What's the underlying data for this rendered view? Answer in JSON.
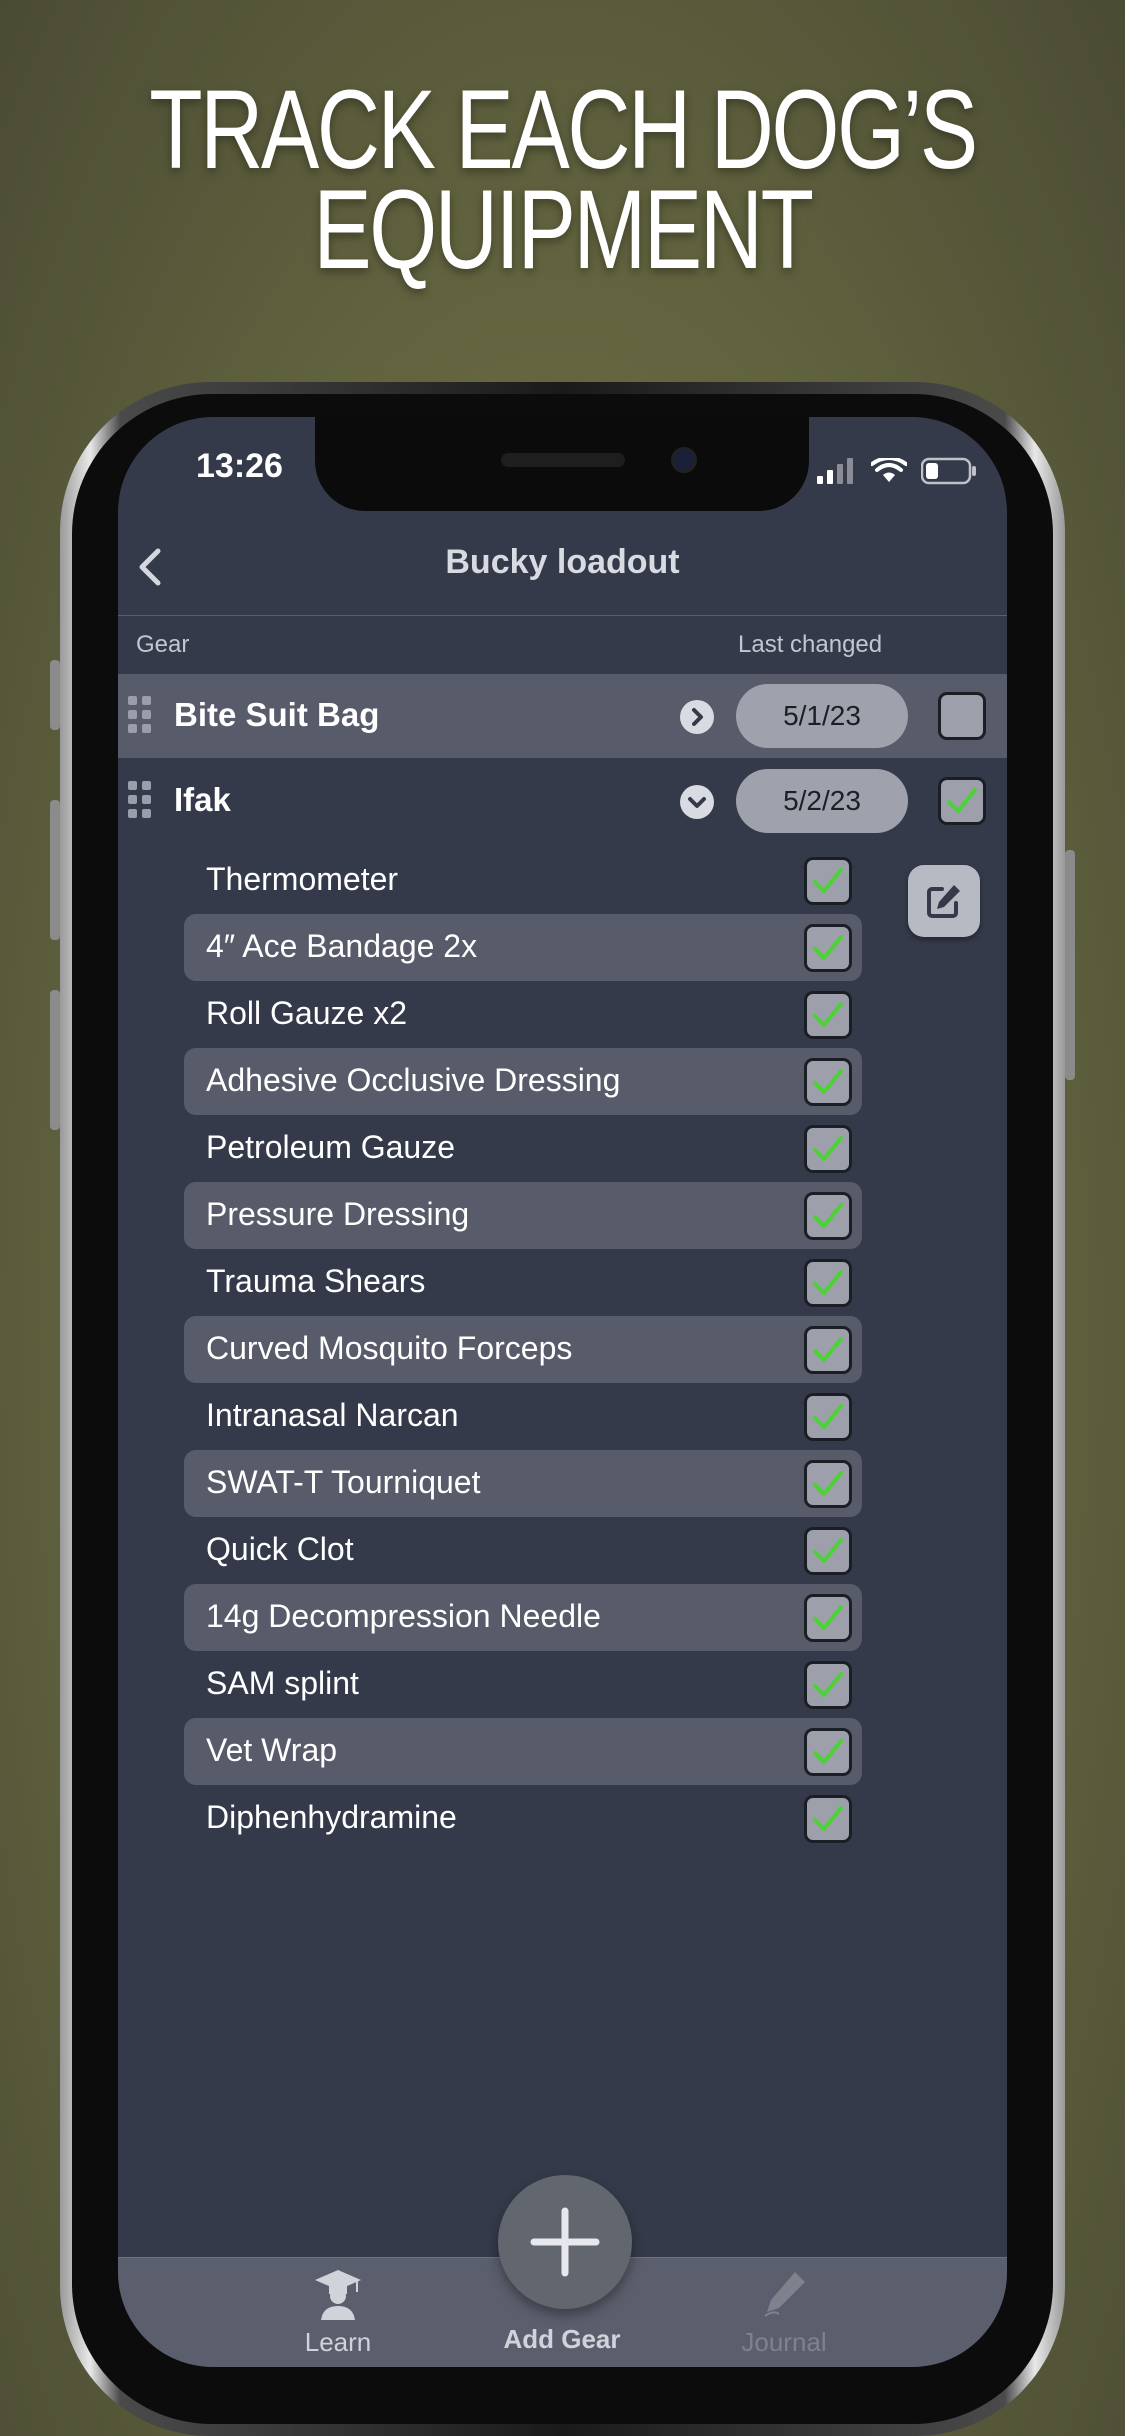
{
  "headline": {
    "line1": "TRACK EACH DOG’S",
    "line2": "EQUIPMENT"
  },
  "status_bar": {
    "time": "13:26"
  },
  "nav": {
    "title": "Bucky loadout"
  },
  "columns": {
    "gear": "Gear",
    "last_changed": "Last changed"
  },
  "groups": [
    {
      "name": "Bite Suit Bag",
      "date": "5/1/23",
      "expanded": false,
      "checked": false
    },
    {
      "name": "Ifak",
      "date": "5/2/23",
      "expanded": true,
      "checked": true
    }
  ],
  "items": [
    {
      "label": "Thermometer",
      "checked": true
    },
    {
      "label": "4″ Ace Bandage 2x",
      "checked": true
    },
    {
      "label": "Roll Gauze x2",
      "checked": true
    },
    {
      "label": "Adhesive Occlusive Dressing",
      "checked": true
    },
    {
      "label": "Petroleum Gauze",
      "checked": true
    },
    {
      "label": "Pressure Dressing",
      "checked": true
    },
    {
      "label": "Trauma Shears",
      "checked": true
    },
    {
      "label": "Curved Mosquito Forceps",
      "checked": true
    },
    {
      "label": "Intranasal Narcan",
      "checked": true
    },
    {
      "label": "SWAT-T Tourniquet",
      "checked": true
    },
    {
      "label": "Quick Clot",
      "checked": true
    },
    {
      "label": "14g Decompression Needle",
      "checked": true
    },
    {
      "label": "SAM splint",
      "checked": true
    },
    {
      "label": "Vet Wrap",
      "checked": true
    },
    {
      "label": "Diphenhydramine",
      "checked": true
    }
  ],
  "tabbar": {
    "learn": "Learn",
    "add_gear": "Add Gear",
    "journal": "Journal"
  },
  "colors": {
    "check_green": "#4cd137",
    "screen_bg": "#353a4a",
    "row_highlight": "#585c6a"
  }
}
